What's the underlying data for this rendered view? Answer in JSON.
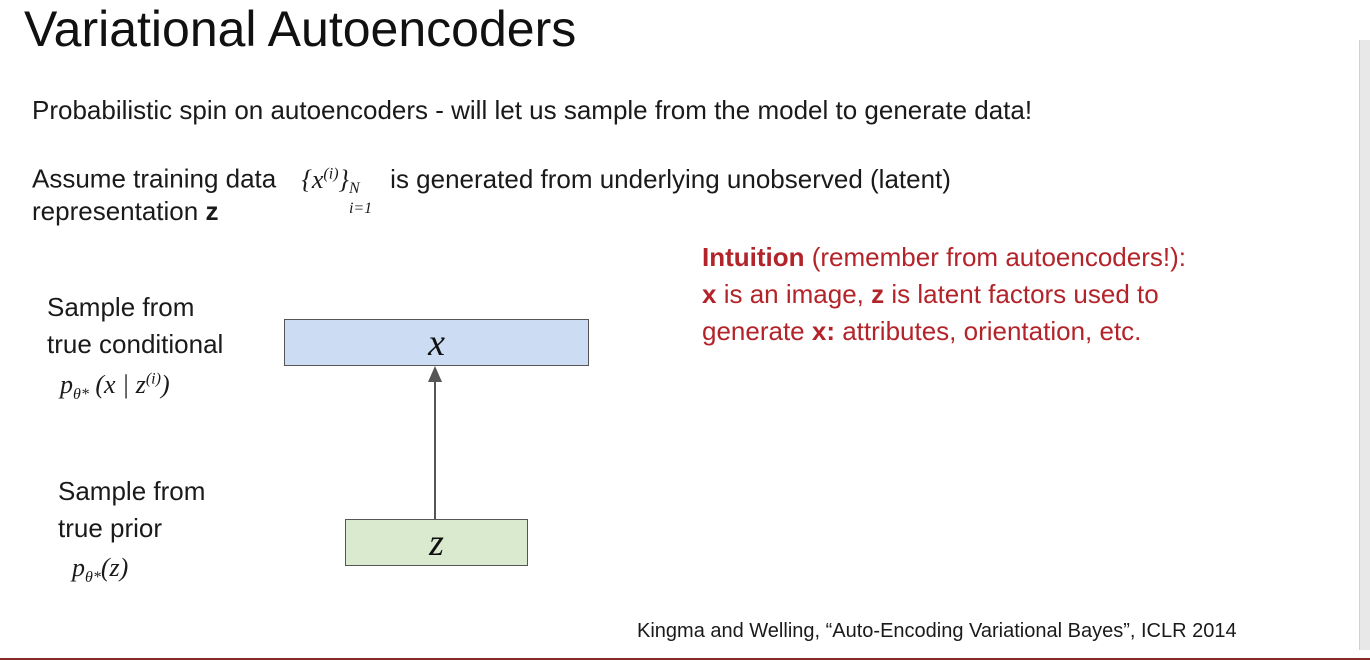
{
  "slide": {
    "title": "Variational Autoencoders",
    "line1": "Probabilistic spin on autoencoders - will let us sample from the model to generate data!",
    "line2_prefix": "Assume training data",
    "line2_math_set": "{x",
    "line2_math_sup": "(i)",
    "line2_math_close": "}",
    "line2_math_sub": "i=1",
    "line2_math_supN": "N",
    "line2_suffix": "is generated from underlying unobserved (latent)",
    "line3_prefix": "representation",
    "line3_bold": "z"
  },
  "diagram": {
    "label_top_line1": "Sample from",
    "label_top_line2": "true conditional",
    "label_top_formula": "p",
    "label_top_formula_sub": "θ*",
    "label_top_formula_rest": "(x | z",
    "label_top_formula_sup": "(i)",
    "label_top_formula_end": ")",
    "label_bottom_line1": "Sample from",
    "label_bottom_line2": "true prior",
    "label_bottom_formula": "p",
    "label_bottom_formula_sub": "θ*",
    "label_bottom_formula_rest": "(z)",
    "box_x": "x",
    "box_z": "z",
    "box_x_color": "#ccdcf2",
    "box_z_color": "#d9eacf"
  },
  "intuition": {
    "bold": "Intuition",
    "rest1": " (remember from autoencoders!):",
    "x_bold": "x",
    "rest2a": " is an image, ",
    "z_bold": "z",
    "rest2b": " is latent factors used to",
    "rest3a": "generate ",
    "x_bold2": "x:",
    "rest3b": " attributes, orientation, etc."
  },
  "citation": "Kingma and Welling, “Auto-Encoding Variational Bayes”, ICLR 2014"
}
